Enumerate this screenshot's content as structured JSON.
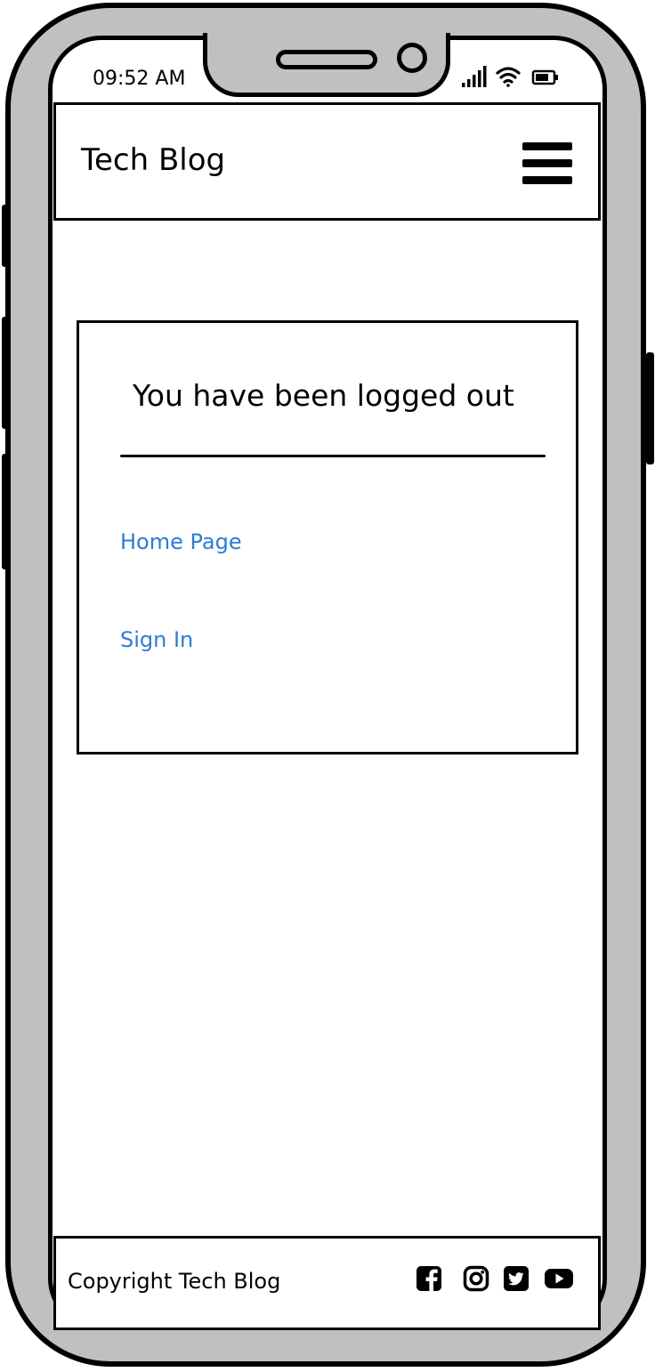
{
  "status_bar": {
    "time": "09:52 AM",
    "icons": [
      "signal-icon",
      "wifi-icon",
      "battery-icon"
    ]
  },
  "header": {
    "brand": "Tech Blog",
    "menu_icon": "hamburger-menu-icon"
  },
  "card": {
    "title": "You have been logged out",
    "links": [
      {
        "label": "Home Page"
      },
      {
        "label": "Sign In"
      }
    ]
  },
  "footer": {
    "copyright": "Copyright Tech Blog",
    "social_icons": [
      "facebook-icon",
      "instagram-icon",
      "twitter-icon",
      "youtube-icon"
    ]
  },
  "colors": {
    "link": "#2f7ad6",
    "frame": "#c0c0c0",
    "ink": "#000000"
  }
}
